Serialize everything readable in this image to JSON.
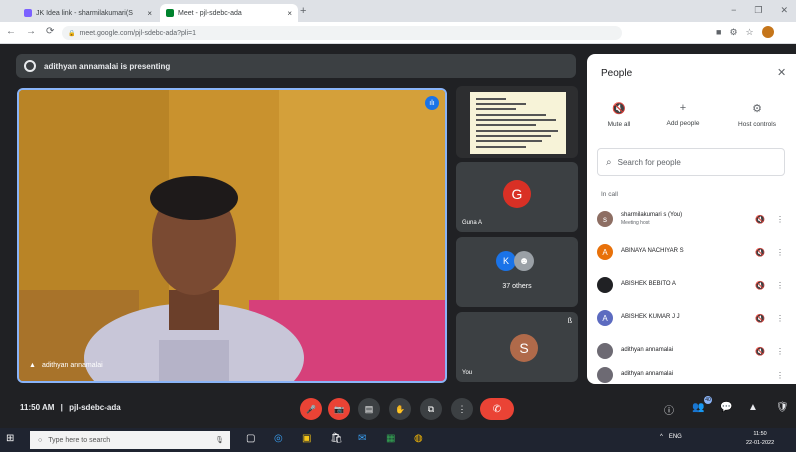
{
  "browser": {
    "tabs": [
      {
        "label": "JK Idea link - sharmilakumari(S",
        "close": "×",
        "icon_color": "#7b61ff"
      },
      {
        "label": "Meet - pjl-sdebc-ada",
        "close": "×",
        "icon_color": "#00832d"
      }
    ],
    "new_tab": "+",
    "window_controls": {
      "minimize": "−",
      "restore": "❐",
      "close": "✕"
    },
    "nav": {
      "back": "←",
      "forward": "→",
      "reload": "⟳"
    },
    "url": "meet.google.com/pjl-sdebc-ada?pli=1",
    "lock": "🔒",
    "addr_icons": {
      "camera": "■",
      "extensions": "⚙",
      "star": "☆"
    }
  },
  "presenting_banner": "adithyan annamalai is presenting",
  "main_tile": {
    "name": "adithyan annamalai",
    "speaking_icon": "ılı",
    "pin_icon": "▲"
  },
  "tiles": [
    {
      "kind": "screen-share"
    },
    {
      "name": "Guna A",
      "initial": "G",
      "color": "#d93025"
    },
    {
      "name": "37 others",
      "initials": [
        "K",
        "☻"
      ]
    },
    {
      "name": "You",
      "initial": "S",
      "color": "#b06a4a",
      "mic_icon": "ß"
    }
  ],
  "panel": {
    "title": "People",
    "close": "✕",
    "actions": [
      {
        "label": "Mute all",
        "icon": "🔇"
      },
      {
        "label": "Add people",
        "icon": "+"
      },
      {
        "label": "Host controls",
        "icon": "⚙"
      }
    ],
    "search_placeholder": "Search for people",
    "search_icon": "⌕",
    "in_call": "In call",
    "participants": [
      {
        "name": "sharmilakumari s (You)",
        "sub": "Meeting host",
        "initial": "s",
        "color": "#8d6e63",
        "mic": "🔇",
        "more": "⋮"
      },
      {
        "name": "ABINAYA NACHIYAR S",
        "sub": "",
        "initial": "A",
        "color": "#e8710a",
        "mic": "🔇",
        "more": "⋮"
      },
      {
        "name": "ABISHEK BEBITO A",
        "sub": "",
        "initial": "",
        "color": "#202124",
        "mic": "🔇",
        "more": "⋮"
      },
      {
        "name": "ABISHEK KUMAR J J",
        "sub": "",
        "initial": "A",
        "color": "#5c6bc0",
        "mic": "🔇",
        "more": "⋮"
      },
      {
        "name": "adithyan annamalai",
        "sub": "",
        "initial": "",
        "color": "#6d6a73",
        "mic": "🔇",
        "more": "⋮"
      },
      {
        "name": "adithyan annamalai",
        "sub": "",
        "initial": "",
        "color": "#6d6a73",
        "mic": "",
        "more": "⋮"
      }
    ]
  },
  "bottom": {
    "time": "11:50 AM",
    "separator": "|",
    "meeting_code": "pjl-sdebc-ada",
    "controls": [
      {
        "name": "mic-off-button",
        "icon": "🎤",
        "style": "red"
      },
      {
        "name": "camera-off-button",
        "icon": "📷",
        "style": "red"
      },
      {
        "name": "captions-button",
        "icon": "▤",
        "style": "grey"
      },
      {
        "name": "raise-hand-button",
        "icon": "✋",
        "style": "grey"
      },
      {
        "name": "present-button",
        "icon": "⧉",
        "style": "grey"
      },
      {
        "name": "more-options-button",
        "icon": "⋮",
        "style": "grey"
      }
    ],
    "end_call_icon": "✆",
    "right_icons": {
      "info": "ⓘ",
      "people": "👥",
      "chat": "💬",
      "activities": "▲",
      "host": "🛡"
    },
    "people_count": "40"
  },
  "taskbar": {
    "start": "⊞",
    "search_placeholder": "Type here to search",
    "search_icon": "○",
    "mic_icon": "🎙",
    "apps": [
      "▢",
      "◎",
      "▣",
      "🛍",
      "✉",
      "▦",
      "◍"
    ],
    "tray_text": "ENG",
    "time": "11:50",
    "date": "22-01-2022"
  }
}
